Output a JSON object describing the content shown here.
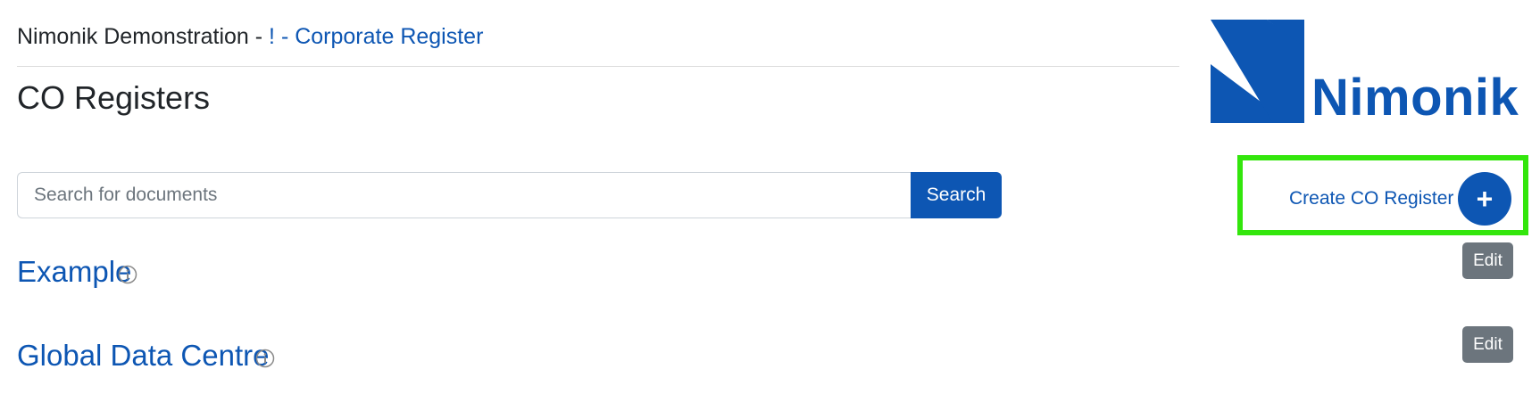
{
  "header": {
    "org_name": "Nimonik Demonstration -",
    "breadcrumb_link": "! - Corporate Register",
    "page_title": "CO Registers"
  },
  "logo": {
    "text": "Nimonik",
    "color": "#0d56b3"
  },
  "search": {
    "placeholder": "Search for documents",
    "value": "",
    "button_label": "Search"
  },
  "create": {
    "label": "Create CO Register",
    "icon": "plus-icon",
    "highlight_color": "#33e60c"
  },
  "registers": [
    {
      "title": "Example",
      "edit_label": "Edit",
      "info_icon": "info-icon"
    },
    {
      "title": "Global Data Centre",
      "edit_label": "Edit",
      "info_icon": "info-icon"
    }
  ],
  "colors": {
    "accent": "#0d56b3",
    "secondary_button": "#6c757d"
  }
}
